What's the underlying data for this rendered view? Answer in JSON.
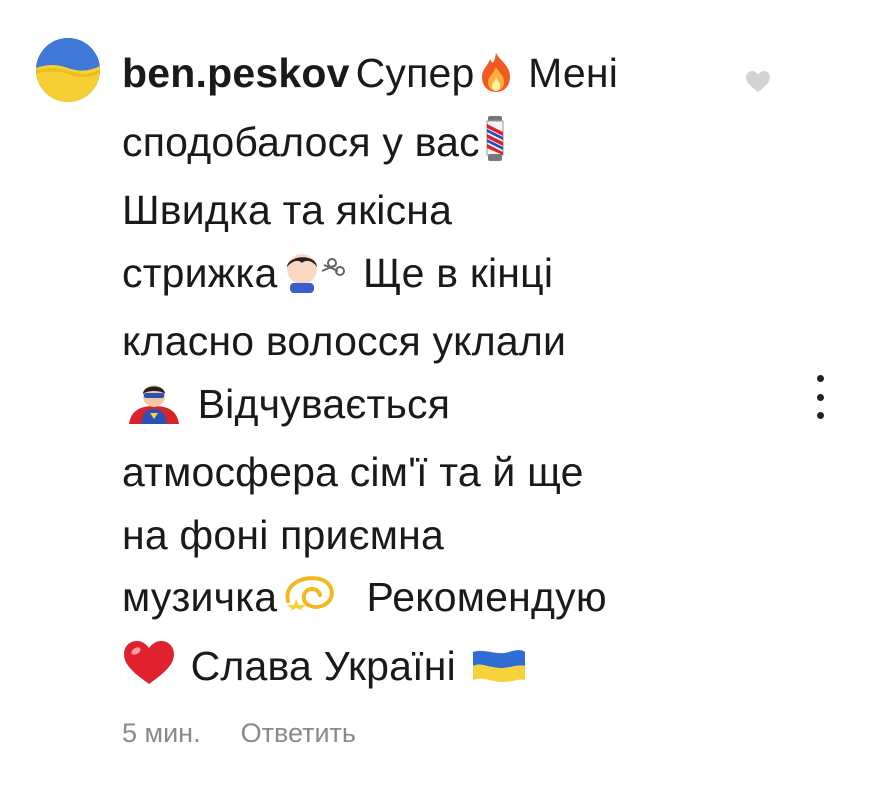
{
  "comment": {
    "username": "ben.peskov",
    "lines": [
      {
        "before": "Супер",
        "emoji": "fire-emoji",
        "after": " Мені"
      },
      {
        "before": "сподобалося у вас",
        "emoji": "barber-pole-emoji",
        "after": ""
      },
      {
        "before": "Швидка та якісна",
        "emoji": "",
        "after": ""
      },
      {
        "before": "стрижка",
        "emoji": "haircut-emoji",
        "after": " Ще в кінці"
      },
      {
        "before": "класно волосся уклали",
        "emoji": "",
        "after": ""
      },
      {
        "before": "",
        "emoji": "superhero-emoji",
        "after": " Відчувається"
      },
      {
        "before": "атмосфера сім'ї та й ще",
        "emoji": "",
        "after": ""
      },
      {
        "before": "на фоні приємна",
        "emoji": "",
        "after": ""
      },
      {
        "before": "музичка",
        "emoji": "dizzy-emoji",
        "after": "  Рекомендую"
      },
      {
        "before": "",
        "emoji": "red-heart-emoji",
        "after": " Слава Україні "
      }
    ],
    "time": "5 мин.",
    "reply_label": "Ответить"
  },
  "icons": {
    "avatar": "ukraine-flag-avatar",
    "like": "heart-outline-icon",
    "more": "more-vertical-icon"
  },
  "colors": {
    "ukraine_blue": "#2f6cd3",
    "ukraine_yellow": "#f7d23a",
    "meta_gray": "#8a8a8a"
  }
}
